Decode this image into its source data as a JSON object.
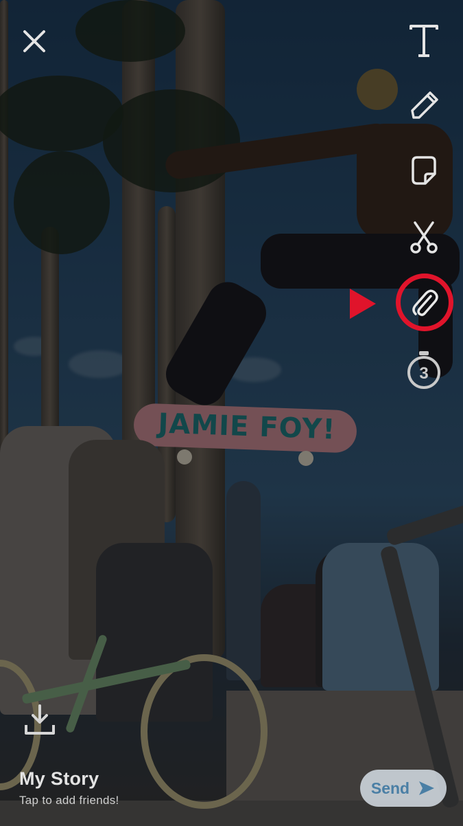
{
  "toolbar": {
    "close_icon": "close-icon",
    "text_icon": "text-tool-icon",
    "pencil_icon": "pencil-icon",
    "sticker_icon": "sticker-icon",
    "scissors_icon": "scissors-icon",
    "attach_icon": "paperclip-icon",
    "timer_icon": "timer-icon",
    "timer_value": "3",
    "text_glyph": "T"
  },
  "highlight": {
    "color": "#e0142b"
  },
  "photo": {
    "board_text": "JAMIE FOY!"
  },
  "footer": {
    "download_icon": "download-icon",
    "story_title": "My Story",
    "story_subtitle": "Tap to add friends!",
    "send_label": "Send",
    "send_color": "#4a7fa5"
  }
}
